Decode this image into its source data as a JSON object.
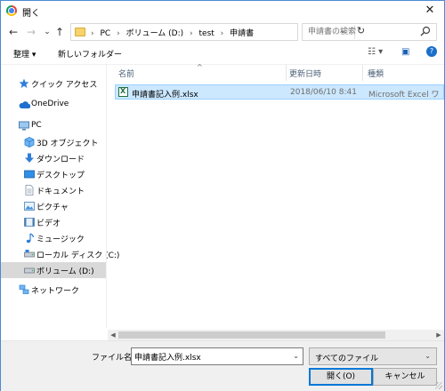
{
  "window": {
    "title": "開く",
    "close_glyph": "✕"
  },
  "nav": {
    "back_glyph": "←",
    "forward_glyph": "→",
    "recent_glyph": "⌄",
    "up_glyph": "↑",
    "breadcrumb": [
      "PC",
      "ボリューム (D:)",
      "test",
      "申請書"
    ],
    "breadcrumb_sep": "›",
    "address_dropdown_glyph": "⌄",
    "refresh_glyph": "↻",
    "search_placeholder": "申請書の検索"
  },
  "toolbar": {
    "organize_label": "整理 ▾",
    "new_folder_label": "新しいフォルダー",
    "view_glyph": "☷ ▾",
    "pane_glyph": "▣",
    "help_glyph": "?"
  },
  "sidebar": {
    "items": [
      {
        "label": "クイック アクセス",
        "icon": "star-icon"
      },
      {
        "label": "OneDrive",
        "icon": "cloud-icon"
      },
      {
        "label": "PC",
        "icon": "pc-icon"
      },
      {
        "label": "3D オブジェクト",
        "icon": "cube-icon"
      },
      {
        "label": "ダウンロード",
        "icon": "download-icon"
      },
      {
        "label": "デスクトップ",
        "icon": "desktop-icon"
      },
      {
        "label": "ドキュメント",
        "icon": "document-icon"
      },
      {
        "label": "ピクチャ",
        "icon": "picture-icon"
      },
      {
        "label": "ビデオ",
        "icon": "video-icon"
      },
      {
        "label": "ミュージック",
        "icon": "music-icon"
      },
      {
        "label": "ローカル ディスク (C:)",
        "icon": "drive-icon"
      },
      {
        "label": "ボリューム (D:)",
        "icon": "drive-icon",
        "selected": true
      },
      {
        "label": "ネットワーク",
        "icon": "network-icon"
      }
    ]
  },
  "columns": {
    "name": "名前",
    "modified": "更新日時",
    "type": "種類",
    "sort_glyph": "^"
  },
  "files": [
    {
      "name": "申請書記入例.xlsx",
      "modified": "2018/06/10 8:41",
      "type": "Microsoft Excel ワ"
    }
  ],
  "bottom": {
    "filename_label": "ファイル名(N):",
    "filename_value": "申請書記入例.xlsx",
    "filetype_value": "すべてのファイル",
    "open_label": "開く(O)",
    "cancel_label": "キャンセル"
  },
  "colors": {
    "accent": "#0078d7",
    "selection": "#cce8ff",
    "folder": "#f6d36b",
    "excel": "#1e7145"
  }
}
